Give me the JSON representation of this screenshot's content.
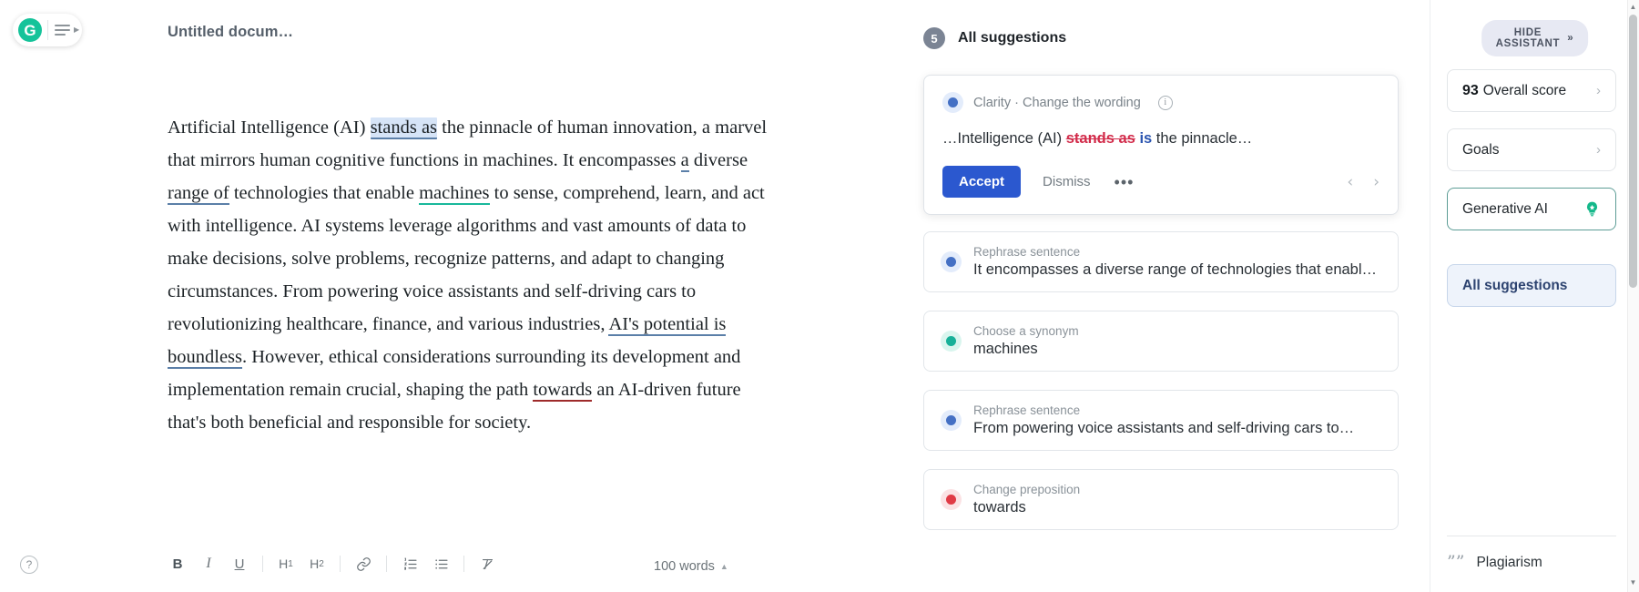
{
  "brand": {
    "logo_letter": "G",
    "accent": "#15c39a"
  },
  "editor": {
    "doc_title": "Untitled docum…",
    "paragraph": {
      "s1a": "Artificial Intelligence (AI) ",
      "s1_active": "stands as",
      "s1b": " the pinnacle of human innovation, a marvel that mirrors human cognitive functions in machines. It encompasses ",
      "s2_a": "a",
      "s2b": " diverse ",
      "s2_range": "range of",
      "s2c": " technologies that enable ",
      "s2_machines": "machines",
      "s2d": " to sense, comprehend, learn, and act with intelligence. AI systems leverage algorithms and vast amounts of data to make decisions, solve problems, recognize patterns, and adapt to changing circumstances. From powering voice assistants and self-driving cars to revolutionizing healthcare, finance, and various industries, ",
      "s3_boundless": "AI's potential is boundless",
      "s3b": ". However, ethical considerations surrounding its development and implementation remain crucial, shaping the path ",
      "s4_towards": "towards",
      "s4b": " an AI-driven future that's both beneficial and responsible for society."
    },
    "toolbar": {
      "bold": "B",
      "italic": "I",
      "underline": "U",
      "h1": "H",
      "h1_sub": "1",
      "h2": "H",
      "h2_sub": "2",
      "link_icon": "link-icon",
      "numbered_list_icon": "numbered-list-icon",
      "bullet_list_icon": "bullet-list-icon",
      "clear_format_icon": "clear-formatting-icon"
    },
    "word_count": "100 words",
    "word_count_caret": "▲",
    "help_label": "?"
  },
  "suggestions_panel": {
    "count_badge": "5",
    "header_title": "All suggestions",
    "active_card": {
      "category": "Clarity · Change the wording",
      "info_icon": "i",
      "sentence_prefix": "…Intelligence (AI) ",
      "sentence_old": "stands as",
      "sentence_new": "is",
      "sentence_suffix": " the pinnacle…",
      "accept_label": "Accept",
      "dismiss_label": "Dismiss",
      "more_label": "•••",
      "prev_arrow": "‹",
      "next_arrow": "›"
    },
    "items": [
      {
        "category": "Rephrase sentence",
        "text": "It encompasses a diverse range of technologies that enable…",
        "dot_type": "clarity"
      },
      {
        "category": "Choose a synonym",
        "text": "machines",
        "dot_type": "synonym"
      },
      {
        "category": "Rephrase sentence",
        "text": "From powering voice assistants and self-driving cars to…",
        "dot_type": "clarity"
      },
      {
        "category": "Change preposition",
        "text": "towards",
        "dot_type": "correct"
      }
    ]
  },
  "sidebar": {
    "hide_assistant_label": "HIDE ASSISTANT",
    "hide_assistant_chevrons": "»",
    "overall_score_value": "93",
    "overall_score_label": "Overall score",
    "goals_label": "Goals",
    "generative_ai_label": "Generative AI",
    "all_suggestions_label": "All suggestions",
    "plagiarism_label": "Plagiarism",
    "chevron": "›"
  }
}
